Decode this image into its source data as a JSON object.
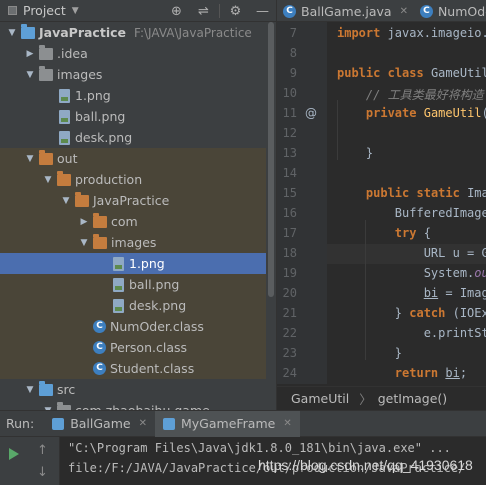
{
  "project_panel": {
    "title": "Project",
    "tools": [
      "⊕",
      "⇌",
      "⚙",
      "—"
    ],
    "tree": [
      {
        "label": "JavaPractice",
        "path": "F:\\JAVA\\JavaPractice",
        "type": "folder-blue",
        "depth": 0,
        "arrow": "open",
        "bold": true
      },
      {
        "label": ".idea",
        "type": "folder",
        "depth": 1,
        "arrow": "closed"
      },
      {
        "label": "images",
        "type": "folder",
        "depth": 1,
        "arrow": "open"
      },
      {
        "label": "1.png",
        "type": "image",
        "depth": 2,
        "arrow": "none"
      },
      {
        "label": "ball.png",
        "type": "image",
        "depth": 2,
        "arrow": "none"
      },
      {
        "label": "desk.png",
        "type": "image",
        "depth": 2,
        "arrow": "none"
      },
      {
        "label": "out",
        "type": "folder-orange",
        "depth": 1,
        "arrow": "open",
        "excluded": true
      },
      {
        "label": "production",
        "type": "folder-orange",
        "depth": 2,
        "arrow": "open",
        "excluded": true
      },
      {
        "label": "JavaPractice",
        "type": "folder-orange",
        "depth": 3,
        "arrow": "open",
        "excluded": true
      },
      {
        "label": "com",
        "type": "folder-orange",
        "depth": 4,
        "arrow": "closed",
        "excluded": true
      },
      {
        "label": "images",
        "type": "folder-orange",
        "depth": 4,
        "arrow": "open",
        "excluded": true
      },
      {
        "label": "1.png",
        "type": "image",
        "depth": 5,
        "arrow": "none",
        "selected": true
      },
      {
        "label": "ball.png",
        "type": "image",
        "depth": 5,
        "arrow": "none",
        "excluded": true
      },
      {
        "label": "desk.png",
        "type": "image",
        "depth": 5,
        "arrow": "none",
        "excluded": true
      },
      {
        "label": "NumOder.class",
        "type": "class",
        "depth": 4,
        "arrow": "none",
        "excluded": true
      },
      {
        "label": "Person.class",
        "type": "class",
        "depth": 4,
        "arrow": "none",
        "excluded": true
      },
      {
        "label": "Student.class",
        "type": "class",
        "depth": 4,
        "arrow": "none",
        "excluded": true
      },
      {
        "label": "src",
        "type": "folder-blue",
        "depth": 1,
        "arrow": "open"
      },
      {
        "label": "com.zhaobaihu.game",
        "type": "folder",
        "depth": 2,
        "arrow": "open"
      }
    ]
  },
  "editor": {
    "tabs": [
      {
        "label": "BallGame.java",
        "active": false
      },
      {
        "label": "NumOde",
        "active": false
      }
    ],
    "lines": [
      {
        "n": "7",
        "text": "import javax.imageio.I"
      },
      {
        "n": "8",
        "text": ""
      },
      {
        "n": "9",
        "text": "public class GameUtil"
      },
      {
        "n": "10",
        "text": "    // 工具类最好将构造"
      },
      {
        "n": "11",
        "text": "    private GameUtil("
      },
      {
        "n": "12",
        "text": ""
      },
      {
        "n": "13",
        "text": "    }"
      },
      {
        "n": "14",
        "text": ""
      },
      {
        "n": "15",
        "text": "    public static Imag"
      },
      {
        "n": "16",
        "text": "        BufferedImage"
      },
      {
        "n": "17",
        "text": "        try {"
      },
      {
        "n": "18",
        "text": "            URL u = Ga"
      },
      {
        "n": "19",
        "text": "            System.out"
      },
      {
        "n": "20",
        "text": "            bi = Image"
      },
      {
        "n": "21",
        "text": "        } catch (IOExc"
      },
      {
        "n": "22",
        "text": "            e.printSta"
      },
      {
        "n": "23",
        "text": "        }"
      },
      {
        "n": "24",
        "text": "        return bi;"
      }
    ],
    "annotation_marker": "@",
    "breadcrumb": [
      "GameUtil",
      "getImage()"
    ]
  },
  "run_panel": {
    "label": "Run:",
    "tabs": [
      {
        "label": "BallGame",
        "active": false
      },
      {
        "label": "MyGameFrame",
        "active": true
      }
    ],
    "console": [
      "\"C:\\Program Files\\Java\\jdk1.8.0_181\\bin\\java.exe\" ...",
      "file:/F:/JAVA/JavaPractice/out/production/JavaPractice/"
    ]
  },
  "watermark": "https://blog.csdn.net/qq_41930618",
  "colors": {
    "panel_bg": "#3c3f41",
    "editor_bg": "#2b2b2b",
    "selection": "#4b6eaf",
    "excluded_bg": "#4a4538",
    "keyword": "#cc7832",
    "comment": "#808080"
  }
}
